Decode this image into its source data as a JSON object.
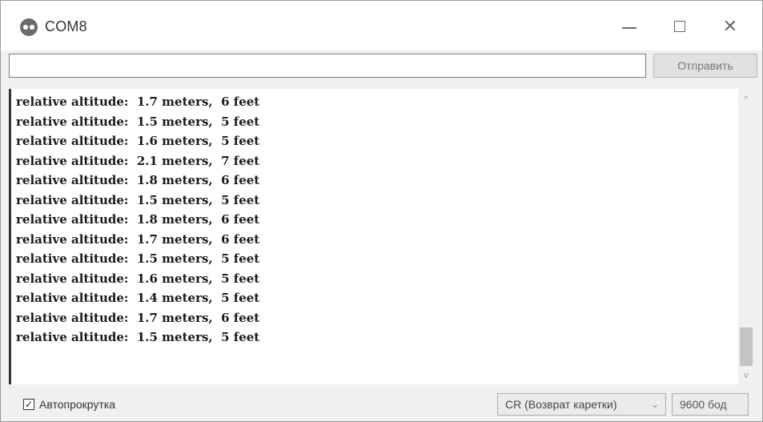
{
  "window": {
    "title": "COM8",
    "controls": {
      "minimize_icon": "minimize-icon",
      "maximize_icon": "maximize-icon",
      "close_icon": "close-icon",
      "close_glyph": "✕"
    }
  },
  "send": {
    "input_value": "",
    "button_label": "Отправить"
  },
  "output": {
    "lines": [
      "relative altitude:  1.7 meters,  6 feet",
      "relative altitude:  1.5 meters,  5 feet",
      "relative altitude:  1.6 meters,  5 feet",
      "relative altitude:  2.1 meters,  7 feet",
      "relative altitude:  1.8 meters,  6 feet",
      "relative altitude:  1.5 meters,  5 feet",
      "relative altitude:  1.8 meters,  6 feet",
      "relative altitude:  1.7 meters,  6 feet",
      "relative altitude:  1.5 meters,  5 feet",
      "relative altitude:  1.6 meters,  5 feet",
      "relative altitude:  1.4 meters,  5 feet",
      "relative altitude:  1.7 meters,  6 feet",
      "relative altitude:  1.5 meters,  5 feet"
    ],
    "scroll_up_glyph": "^",
    "scroll_down_glyph": "v"
  },
  "status": {
    "autoscroll_checked": true,
    "autoscroll_check_glyph": "✓",
    "autoscroll_label": "Автопрокрутка",
    "line_ending": "CR (Возврат каретки)",
    "line_ending_chevron": "⌄",
    "baud_rate": "9600 бод"
  },
  "colors": {
    "window_bg": "#f0f0f0",
    "output_bg": "#ffffff",
    "text": "#1a1a1a"
  }
}
